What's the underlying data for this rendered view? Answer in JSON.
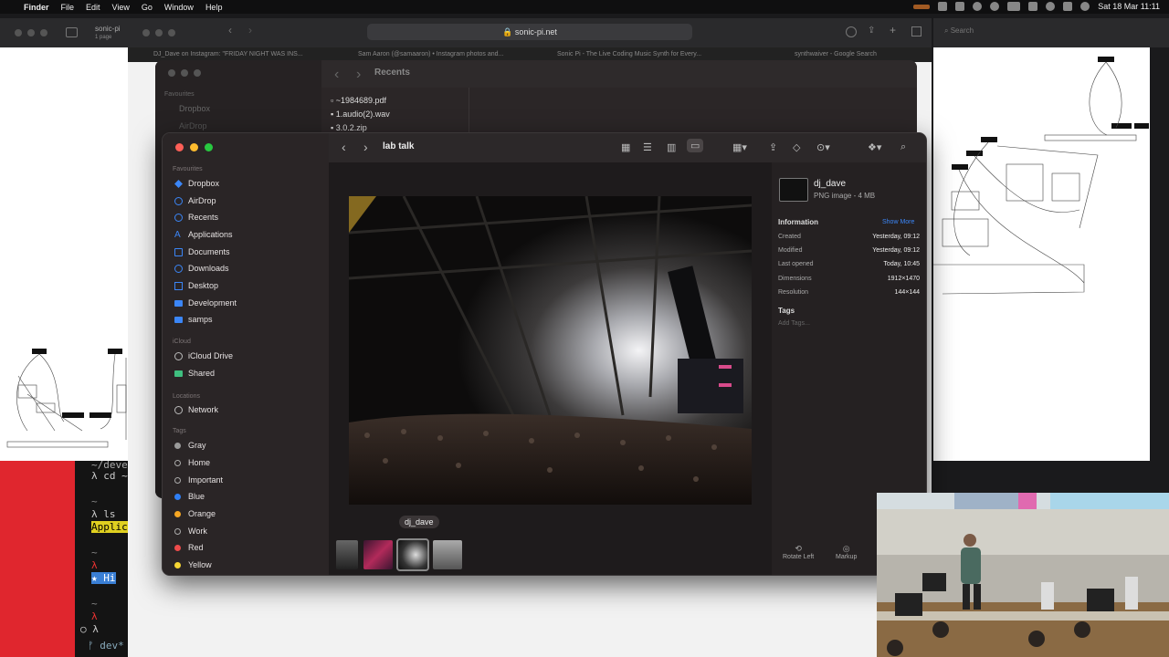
{
  "menubar": {
    "app_name": "Finder",
    "menus": [
      "File",
      "Edit",
      "View",
      "Go",
      "Window",
      "Help"
    ],
    "clock": "Sat 18 Mar  11:11"
  },
  "safari": {
    "url": "sonic-pi.net",
    "tabs": [
      "DJ_Dave on Instagram: \"FRIDAY NIGHT WAS INS...",
      "Sam Aaron (@samaaron) • Instagram photos and...",
      "Sonic Pi - The Live Coding Music Synth for Every...",
      "synthwaiver - Google Search"
    ],
    "left_title": "sonic-pi",
    "left_sub": "1 page",
    "search_placeholder": "Search"
  },
  "back_finder": {
    "title": "Recents",
    "files": [
      "~1984689.pdf",
      "1.audio(2).wav",
      "3.0.2.zip"
    ],
    "sidebar_head": "Favourites",
    "sidebar_items": [
      "Dropbox",
      "AirDrop"
    ]
  },
  "terminal": {
    "lines": [
      "~/deve",
      "λ cd ~",
      "~",
      "λ ls",
      "Applic",
      "~",
      "λ",
      "★ Hi",
      "~",
      "λ",
      "○ λ",
      "ᚠ dev*"
    ]
  },
  "finder": {
    "title": "lab talk",
    "sidebar": {
      "favourites_label": "Favourites",
      "favourites": [
        {
          "label": "Dropbox",
          "icon": "dropbox-icon"
        },
        {
          "label": "AirDrop",
          "icon": "airdrop-icon"
        },
        {
          "label": "Recents",
          "icon": "clock-icon"
        },
        {
          "label": "Applications",
          "icon": "applications-icon"
        },
        {
          "label": "Documents",
          "icon": "document-icon"
        },
        {
          "label": "Downloads",
          "icon": "download-icon"
        },
        {
          "label": "Desktop",
          "icon": "desktop-icon"
        },
        {
          "label": "Development",
          "icon": "folder-icon"
        },
        {
          "label": "samps",
          "icon": "folder-icon"
        }
      ],
      "icloud_label": "iCloud",
      "icloud": [
        {
          "label": "iCloud Drive",
          "icon": "cloud-icon"
        },
        {
          "label": "Shared",
          "icon": "shared-folder-icon"
        }
      ],
      "locations_label": "Locations",
      "locations": [
        {
          "label": "Network",
          "icon": "globe-icon"
        }
      ],
      "tags_label": "Tags",
      "tags": [
        {
          "label": "Gray",
          "color": "#9a9a9a"
        },
        {
          "label": "Home",
          "color": "none"
        },
        {
          "label": "Important",
          "color": "none"
        },
        {
          "label": "Blue",
          "color": "#2f7ff5"
        },
        {
          "label": "Orange",
          "color": "#f5a623"
        },
        {
          "label": "Work",
          "color": "none"
        },
        {
          "label": "Red",
          "color": "#ee4b4b"
        },
        {
          "label": "Yellow",
          "color": "#f5d533"
        }
      ]
    },
    "preview": {
      "caption": "dj_dave"
    },
    "info": {
      "file_name": "dj_dave",
      "file_sub": "PNG image - 4 MB",
      "information_label": "Information",
      "show_more": "Show More",
      "rows": [
        {
          "k": "Created",
          "v": "Yesterday, 09:12"
        },
        {
          "k": "Modified",
          "v": "Yesterday, 09:12"
        },
        {
          "k": "Last opened",
          "v": "Today, 10:45"
        },
        {
          "k": "Dimensions",
          "v": "1912×1470"
        },
        {
          "k": "Resolution",
          "v": "144×144"
        }
      ],
      "tags_label": "Tags",
      "add_tags": "Add Tags...",
      "rotate_left": "Rotate Left",
      "markup": "Markup"
    }
  }
}
